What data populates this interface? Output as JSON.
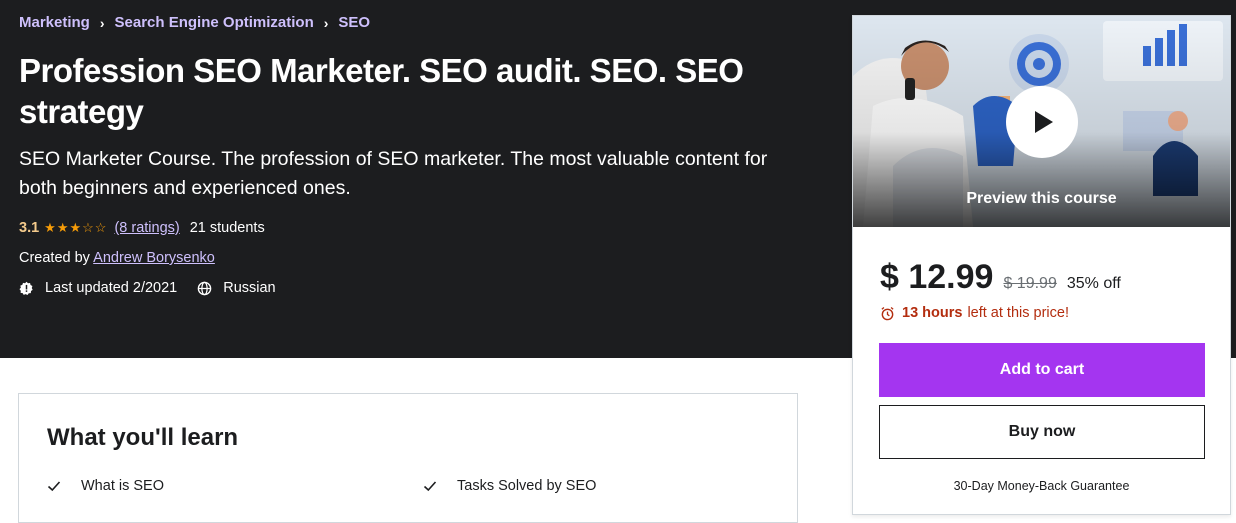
{
  "breadcrumb": {
    "items": [
      "Marketing",
      "Search Engine Optimization",
      "SEO"
    ],
    "separator": "›"
  },
  "course": {
    "title": "Profession SEO Marketer. SEO audit. SEO. SEO strategy",
    "subtitle": "SEO Marketer Course. The profession of SEO marketer. The most valuable content for both beginners and experienced ones.",
    "rating": "3.1",
    "stars_filled": 3,
    "stars_total": 5,
    "ratings_link": "(8 ratings)",
    "students": "21 students",
    "created_by_label": "Created by",
    "author": "Andrew Borysenko",
    "last_updated": "Last updated 2/2021",
    "language": "Russian"
  },
  "learn": {
    "title": "What you'll learn",
    "items": [
      "What is SEO",
      "Tasks Solved by SEO"
    ]
  },
  "sidebar": {
    "preview_label": "Preview this course",
    "price": "$ 12.99",
    "original_price": "$ 19.99",
    "discount": "35% off",
    "timer_hours": "13 hours",
    "timer_text": "left at this price!",
    "add_to_cart": "Add to cart",
    "buy_now": "Buy now",
    "guarantee": "30-Day Money-Back Guarantee"
  },
  "colors": {
    "hero_bg": "#1c1d1f",
    "link_purple": "#cec0fc",
    "rating_gold": "#f3ca8c",
    "star_orange": "#f69c08",
    "cart_purple": "#a435f0",
    "timer_red": "#b32d0f"
  }
}
